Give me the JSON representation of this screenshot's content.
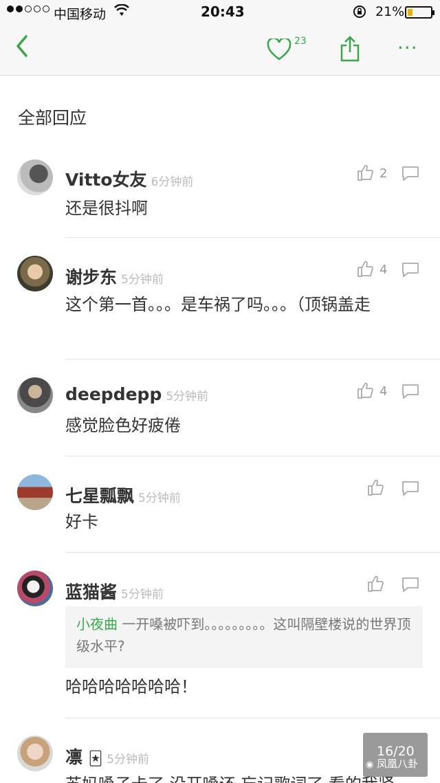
{
  "status_bar": {
    "carrier": "中国移动",
    "time": "20:43",
    "battery_text": "21%",
    "battery_level": 0.21
  },
  "nav": {
    "back_icon": "chevron-left-icon",
    "like_count": "23",
    "more_label": "···"
  },
  "section_title": "全部回应",
  "comments": [
    {
      "username": "Vitto女友",
      "time": "6分钟前",
      "likes": "2",
      "text": "还是很抖啊"
    },
    {
      "username": "谢步东",
      "time": "5分钟前",
      "likes": "4",
      "text": "这个第一首。。。是车祸了吗。。。（顶锅盖走"
    },
    {
      "username": "deepdepp",
      "time": "5分钟前",
      "likes": "4",
      "text": "感觉脸色好疲倦"
    },
    {
      "username": "七星瓢飘",
      "time": "5分钟前",
      "likes": "",
      "text": "好卡"
    },
    {
      "username": "蓝猫酱",
      "time": "5分钟前",
      "likes": "",
      "quote_user": "小夜曲",
      "quote_text": " 一开嗓被吓到。。。。。。。。。这叫隔壁楼说的世界顶级水平?",
      "text": "哈哈哈哈哈哈哈！"
    },
    {
      "username": "凛",
      "emoji": "🃏",
      "time": "5分钟前",
      "likes": "",
      "text": "苏妈嗓子卡了 没开嗓还 忘记歌词了 看的我紧"
    }
  ],
  "pager": {
    "text": "16/20"
  },
  "watermark": {
    "text": "凤凰八卦"
  },
  "colors": {
    "accent": "#3aa64c"
  }
}
